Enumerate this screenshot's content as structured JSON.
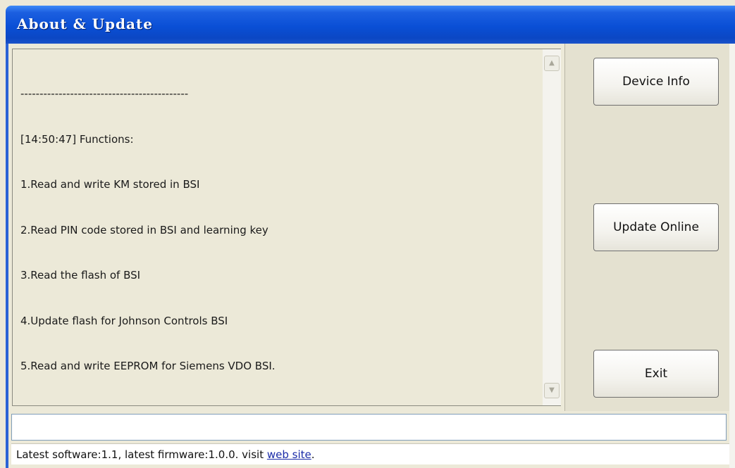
{
  "window": {
    "title": "About & Update"
  },
  "log": {
    "lines": [
      "--------------------------------------------",
      "[14:50:47] Functions:",
      "1.Read and write KM stored in BSI",
      "2.Read PIN code stored in BSI and learning key",
      "3.Read the flash of BSI",
      "4.Update flash for Johnson Controls BSI",
      "5.Read and write EEPROM for Siemens VDO BSI."
    ]
  },
  "buttons": {
    "device_info": "Device Info",
    "update_online": "Update Online",
    "exit": "Exit"
  },
  "input": {
    "value": ""
  },
  "status": {
    "text": "Latest software:1.1, latest firmware:1.0.0. visit ",
    "link": "web site",
    "suffix": "."
  },
  "icons": {
    "scroll_up": "scroll-up-arrow",
    "scroll_down": "scroll-down-arrow"
  }
}
